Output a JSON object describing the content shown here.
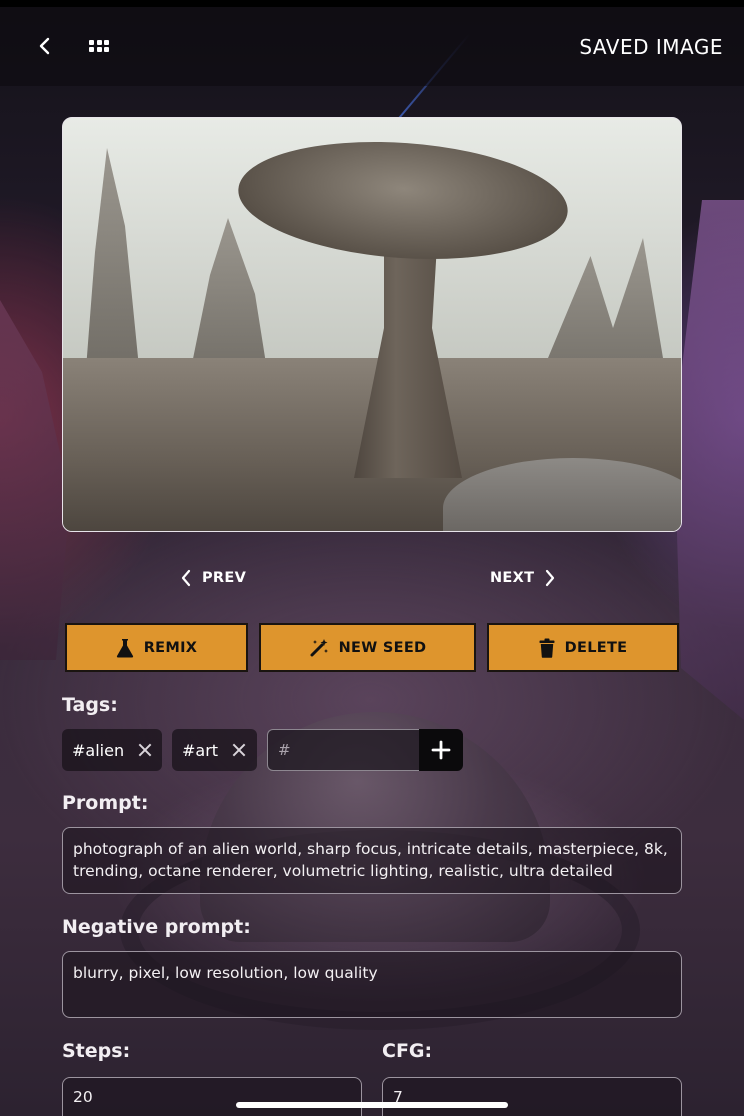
{
  "header": {
    "title": "SAVED IMAGE",
    "back_icon": "chevron-left-icon",
    "grid_icon": "grid-icon"
  },
  "navigation": {
    "prev_label": "PREV",
    "next_label": "NEXT"
  },
  "actions": {
    "remix_label": "REMIX",
    "new_seed_label": "NEW SEED",
    "delete_label": "DELETE",
    "button_color": "#de952d"
  },
  "tags": {
    "label": "Tags:",
    "items": [
      {
        "text": "#alien"
      },
      {
        "text": "#art"
      }
    ],
    "input_placeholder": "#"
  },
  "prompt": {
    "label": "Prompt:",
    "value": "photograph of an alien world, sharp focus, intricate details, masterpiece, 8k, trending, octane renderer, volumetric lighting, realistic, ultra detailed"
  },
  "negative_prompt": {
    "label": "Negative prompt:",
    "value": "blurry, pixel, low resolution, low quality"
  },
  "steps": {
    "label": "Steps:",
    "value": "20"
  },
  "cfg": {
    "label": "CFG:",
    "value": "7"
  }
}
